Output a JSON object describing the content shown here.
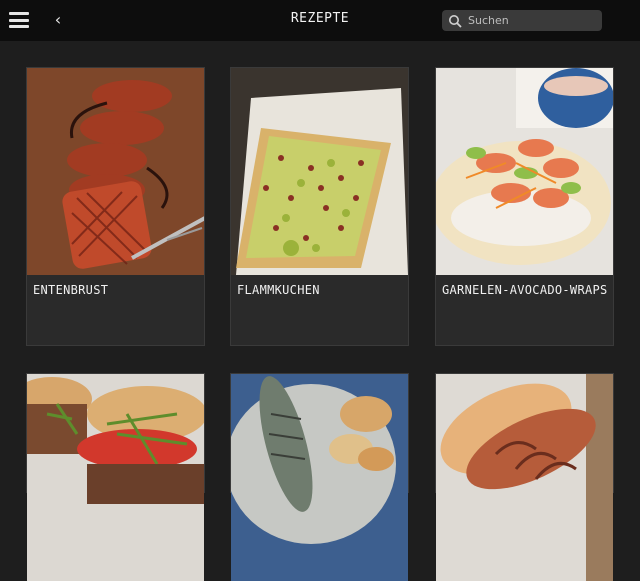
{
  "header": {
    "title": "REZEPTE",
    "search_placeholder": "Suchen",
    "menu_icon": "hamburger-menu-icon",
    "back_icon": "chevron-left-icon",
    "search_icon": "search-icon"
  },
  "recipes": [
    {
      "label": "ENTENBRUST"
    },
    {
      "label": "FLAMMKUCHEN"
    },
    {
      "label": "GARNELEN-AVOCADO-WRAPS"
    },
    {
      "label": ""
    },
    {
      "label": ""
    },
    {
      "label": ""
    }
  ],
  "colors": {
    "background": "#1e1e1e",
    "topbar": "#0d0d0d",
    "card": "#2a2a2a",
    "text": "#f0f0f0"
  }
}
